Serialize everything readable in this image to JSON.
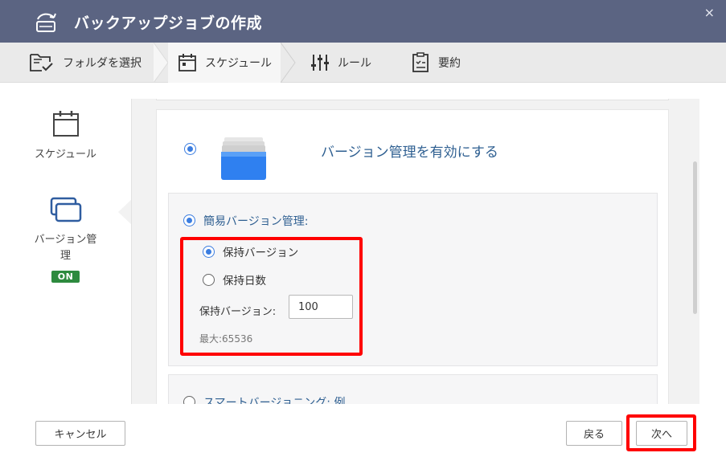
{
  "window": {
    "title": "バックアップジョブの作成",
    "close_glyph": "×"
  },
  "steps": [
    {
      "label": "フォルダを選択",
      "icon": "folder-check-icon"
    },
    {
      "label": "スケジュール",
      "icon": "calendar-icon",
      "active": true
    },
    {
      "label": "ルール",
      "icon": "sliders-icon"
    },
    {
      "label": "要約",
      "icon": "clipboard-icon"
    }
  ],
  "sidebar": {
    "items": [
      {
        "label": "スケジュール",
        "icon": "calendar-icon"
      },
      {
        "label_line1": "バージョン管",
        "label_line2": "理",
        "icon": "versions-icon",
        "badge": "ON"
      }
    ]
  },
  "versioning": {
    "enable_label": "バージョン管理を有効にする",
    "simple": {
      "title": "簡易バージョン管理:",
      "option_keep_versions": "保持バージョン",
      "option_keep_days": "保持日数",
      "keep_label": "保持バージョン:",
      "keep_value": "100",
      "max_text": "最大:65536"
    },
    "smart": {
      "title": "スマートバージョニング: 例"
    }
  },
  "footer": {
    "cancel": "キャンセル",
    "back": "戻る",
    "next": "次へ"
  },
  "colors": {
    "titlebar": "#5b6482",
    "accent_blue": "#3b7de0",
    "label_blue": "#2e5f91",
    "badge_green": "#2d8a3e",
    "highlight_red": "#ff0000"
  }
}
